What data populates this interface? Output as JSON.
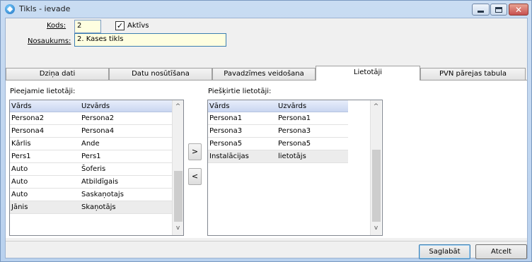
{
  "window": {
    "title": "Tikls - ievade",
    "minimize_glyph": "",
    "close_glyph": "✕"
  },
  "form": {
    "kods_label": "Kods:",
    "kods_value": "2",
    "aktivs_label": "Aktīvs",
    "aktivs_checked": true,
    "check_glyph": "✓",
    "nosaukums_label": "Nosaukums:",
    "nosaukums_value": "2. Kases tikls"
  },
  "tabs": [
    {
      "label": "Dziņa dati",
      "active": false
    },
    {
      "label": "Datu nosūtīšana",
      "active": false
    },
    {
      "label": "Pavadzīmes veidošana",
      "active": false
    },
    {
      "label": "Lietotāji",
      "active": true
    },
    {
      "label": "PVN pārejas tabula",
      "active": false
    }
  ],
  "available_users": {
    "label": "Pieejamie lietotāji:",
    "columns": [
      "Vārds",
      "Uzvārds"
    ],
    "rows": [
      [
        "Persona2",
        "Persona2"
      ],
      [
        "Persona4",
        "Persona4"
      ],
      [
        "Kārlis",
        "Ande"
      ],
      [
        "Pers1",
        "Pers1"
      ],
      [
        "Auto",
        "Šoferis"
      ],
      [
        "Auto",
        "Atbildīgais"
      ],
      [
        "Auto",
        "Saskaņotajs"
      ],
      [
        "Jānis",
        "Skaņotājs"
      ]
    ]
  },
  "assigned_users": {
    "label": "Piešķirtie lietotāji:",
    "columns": [
      "Vārds",
      "Uzvārds"
    ],
    "rows": [
      [
        "Persona1",
        "Persona1"
      ],
      [
        "Persona3",
        "Persona3"
      ],
      [
        "Persona5",
        "Persona5"
      ],
      [
        "Instalācijas",
        "lietotājs"
      ]
    ]
  },
  "move": {
    "add_label": ">",
    "remove_label": "<"
  },
  "scroll": {
    "up_glyph": "^",
    "down_glyph": "v"
  },
  "buttons": {
    "save_label": "Saglabāt",
    "cancel_label": "Atcelt"
  }
}
